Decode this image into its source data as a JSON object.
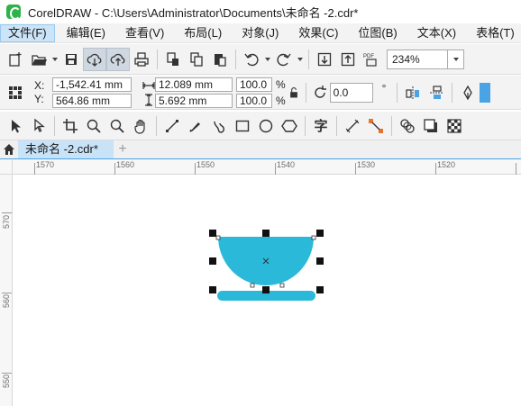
{
  "app": {
    "title": "CorelDRAW - C:\\Users\\Administrator\\Documents\\未命名 -2.cdr*"
  },
  "menu": {
    "items": [
      {
        "label": "文件(F)",
        "active": true
      },
      {
        "label": "编辑(E)"
      },
      {
        "label": "查看(V)"
      },
      {
        "label": "布局(L)"
      },
      {
        "label": "对象(J)"
      },
      {
        "label": "效果(C)"
      },
      {
        "label": "位图(B)"
      },
      {
        "label": "文本(X)"
      },
      {
        "label": "表格(T)"
      }
    ]
  },
  "toolbar": {
    "zoom": "234%",
    "pdf_label": "PDF",
    "icons": [
      "new-document-icon",
      "open-folder-icon",
      "save-icon",
      "cloud-download-icon",
      "cloud-upload-icon",
      "print-icon",
      "cut-icon",
      "copy-icon",
      "paste-icon",
      "undo-icon",
      "redo-icon",
      "import-icon",
      "export-icon",
      "publish-pdf-icon"
    ]
  },
  "property_bar": {
    "x_label": "X:",
    "x_value": "-1,542.41 mm",
    "y_label": "Y:",
    "y_value": "564.86 mm",
    "width_value": "12.089 mm",
    "height_value": "5.692 mm",
    "scale_x": "100.0",
    "scale_y": "100.0",
    "percent": "%",
    "rotation": "0.0",
    "degree_symbol": "°"
  },
  "tools": {
    "text_tool_glyph": "字",
    "icons": [
      "pick-tool-icon",
      "shape-tool-icon",
      "crop-tool-icon",
      "zoom-tool-icon",
      "pan-tool-icon",
      "freehand-tool-icon",
      "artistic-media-icon",
      "smart-fill-icon",
      "rectangle-tool-icon",
      "ellipse-tool-icon",
      "polygon-tool-icon",
      "text-tool-icon",
      "parallel-dimension-icon",
      "connector-tool-icon",
      "blend-tool-icon",
      "drop-shadow-icon",
      "transparency-icon"
    ]
  },
  "tabs": {
    "document": "未命名 -2.cdr*",
    "add": "+"
  },
  "ruler": {
    "h_labels": [
      "1570",
      "1560",
      "1550",
      "1540",
      "1530",
      "1520"
    ],
    "v_labels": [
      "570",
      "560",
      "550"
    ]
  },
  "colors": {
    "shape_fill": "#2bb9d9",
    "accent": "#4aa3e4"
  }
}
